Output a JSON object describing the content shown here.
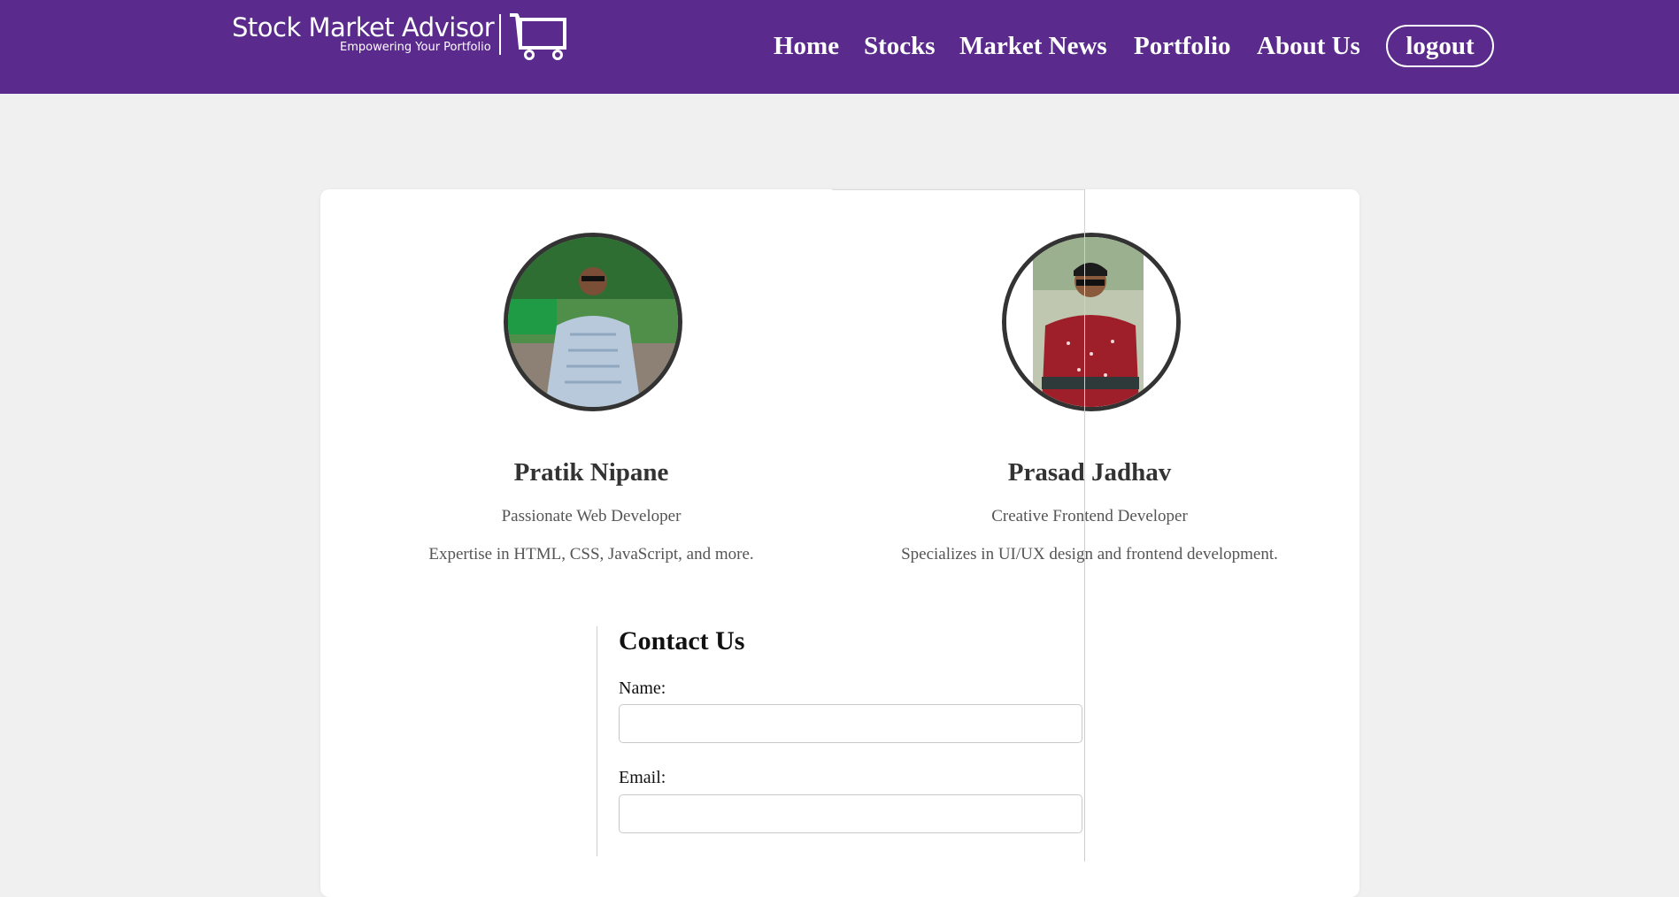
{
  "brand": {
    "title": "Stock Market Advisor",
    "tagline": "Empowering Your Portfolio",
    "icon": "shopping-cart-icon"
  },
  "nav": {
    "home": "Home",
    "stocks": "Stocks",
    "news": "Market News",
    "portfolio": "Portfolio",
    "about": "About Us",
    "logout": "logout"
  },
  "colors": {
    "header_bg": "#5a2a8c",
    "page_bg": "#f0f0f0",
    "card_bg": "#ffffff"
  },
  "team": [
    {
      "name": "Pratik Nipane",
      "role": "Passionate Web Developer",
      "description": "Expertise in HTML, CSS, JavaScript, and more."
    },
    {
      "name": "Prasad Jadhav",
      "role": "Creative Frontend Developer",
      "description": "Specializes in UI/UX design and frontend development."
    }
  ],
  "contact": {
    "title": "Contact Us",
    "name_label": "Name:",
    "name_value": "",
    "email_label": "Email:",
    "email_value": ""
  }
}
